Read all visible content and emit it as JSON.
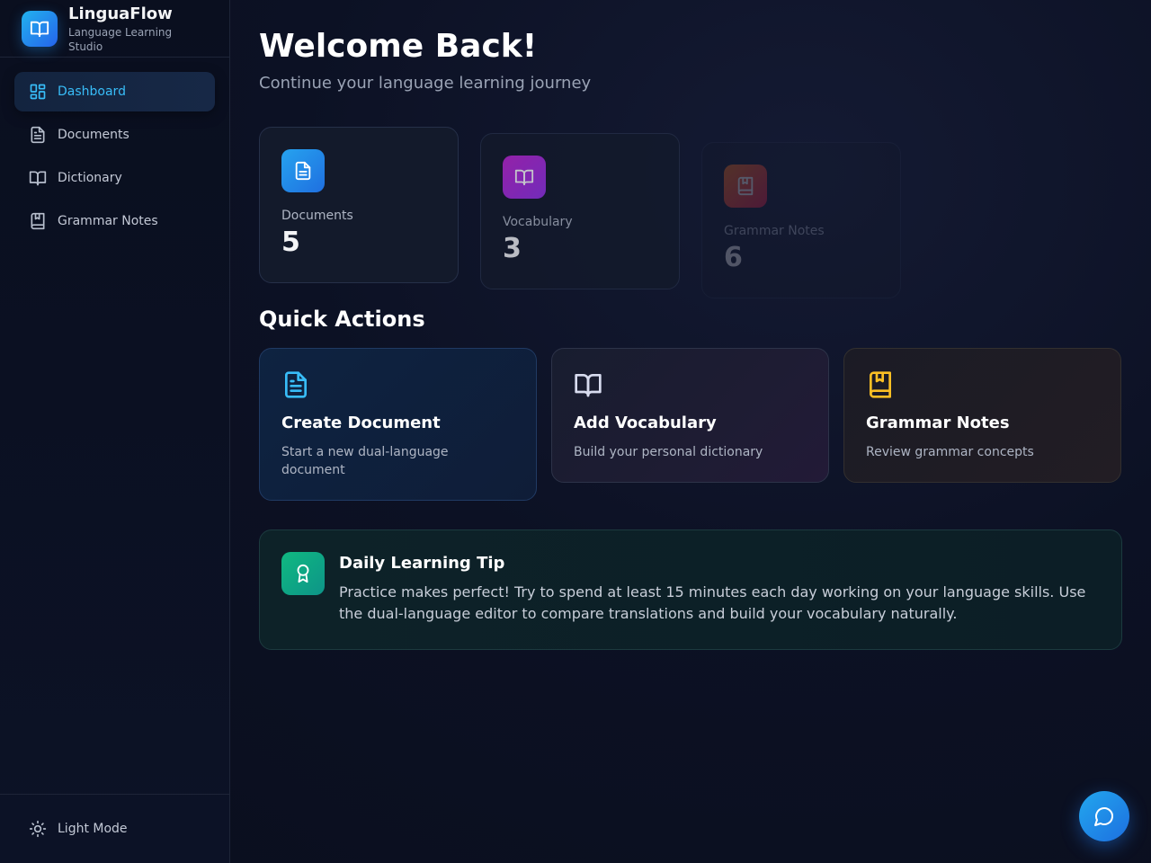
{
  "brand": {
    "name": "LinguaFlow",
    "subtitle": "Language Learning Studio",
    "icon": "book-open-icon"
  },
  "sidebar": {
    "items": [
      {
        "label": "Dashboard",
        "icon": "grid-icon",
        "active": true
      },
      {
        "label": "Documents",
        "icon": "document-icon",
        "active": false
      },
      {
        "label": "Dictionary",
        "icon": "book-open-icon",
        "active": false
      },
      {
        "label": "Grammar Notes",
        "icon": "bookmark-book-icon",
        "active": false
      }
    ],
    "footer": {
      "label": "Light Mode",
      "icon": "sun-icon"
    }
  },
  "header": {
    "title": "Welcome Back!",
    "subtitle": "Continue your language learning journey"
  },
  "stats": [
    {
      "label": "Documents",
      "value": "5",
      "icon": "document-icon",
      "color": "#2b8ff0"
    },
    {
      "label": "Vocabulary",
      "value": "3",
      "icon": "book-open-icon",
      "color": "#c026d3"
    },
    {
      "label": "Grammar Notes",
      "value": "6",
      "icon": "bookmark-book-icon",
      "color": "#f97316"
    }
  ],
  "quick_actions": {
    "title": "Quick Actions",
    "items": [
      {
        "title": "Create Document",
        "description": "Start a new dual-language document",
        "icon": "document-icon",
        "color": "#38bdf8"
      },
      {
        "title": "Add Vocabulary",
        "description": "Build your personal dictionary",
        "icon": "book-open-icon",
        "color": "#d8dcef"
      },
      {
        "title": "Grammar Notes",
        "description": "Review grammar concepts",
        "icon": "bookmark-book-icon",
        "color": "#fbbf24"
      }
    ]
  },
  "tip": {
    "title": "Daily Learning Tip",
    "text": "Practice makes perfect! Try to spend at least 15 minutes each day working on your language skills. Use the dual-language editor to compare translations and build your vocabulary naturally.",
    "icon": "award-icon",
    "color": "#10b981"
  },
  "chat_button": {
    "icon": "chat-bubble-icon"
  }
}
